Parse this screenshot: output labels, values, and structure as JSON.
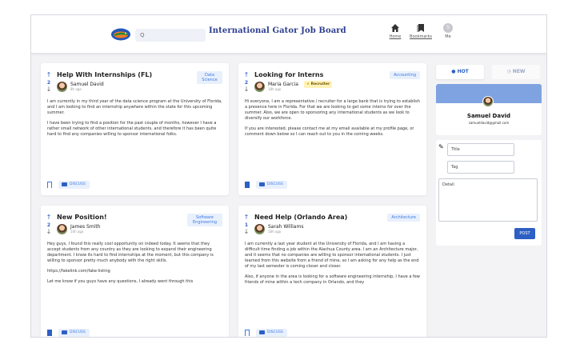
{
  "header": {
    "search_placeholder": "Q",
    "brand": "International Gator Job Board",
    "nav": {
      "home": "Home",
      "bookmarks": "Bookmarks",
      "me": "Me",
      "me_initial": "S"
    }
  },
  "posts": [
    {
      "title": "Help With Internships (FL)",
      "votes": "2",
      "author": "Samuel David",
      "time": "8h ago",
      "tag": "Data Science",
      "body": [
        "I am currently in my third year of the data science program at the University of Florida, and I am looking to find an internship anywhere within the state for this upcoming summer.",
        "I have been trying to find a position for the past couple of months, however I have a rather small network of other international students, and therefore it has been quite hard to find any companies willing to sponsor international folks."
      ],
      "discuss": "DISCUSS",
      "bookmarked": false
    },
    {
      "title": "Looking for Interns",
      "votes": "2",
      "author": "Maria Garcia",
      "badge": "Recruiter",
      "time": "18h ago",
      "tag": "Accounting",
      "body": [
        "Hi everyone, I am a representative / recruiter for a large bank that is trying to establish a presence here in Florida. For that we are looking to get some interns for over the summer. Also, we are open to sponsoring any international students as we look to diversify our workforce.",
        "If you are interested, please contact me at my email available at my profile page, or comment down below so I can reach out to you in the coming weeks."
      ],
      "discuss": "DISCUSS",
      "bookmarked": true
    },
    {
      "title": "New Position!",
      "votes": "2",
      "author": "James Smith",
      "time": "10h ago",
      "tag": "Software Engineering",
      "body": [
        "Hey guys, I found this really cool opportunity on indeed today. It seems that they accept students from any country as they are looking to expand their engineering department. I know its hard to find internships at the moment, but this company is willing to sponsor pretty much anybody with the right skills.",
        "https://fakelink.com/fake-listing",
        "Let me know if you guys have any questions, I already went through this"
      ],
      "discuss": "DISCUSS",
      "bookmarked": true
    },
    {
      "title": "Need Help (Orlando Area)",
      "votes": "1",
      "author": "Sarah Williams",
      "time": "18h ago",
      "tag": "Architecture",
      "body": [
        "I am currently a last year student at the University of Florida, and I am having a difficult time finding a job within the Alachua County area. I am an Architecture major, and it seems that no companies are willing to sponsor international students. I just learned from this website from a friend of mine, so I am asking for any help as the end of my last semester is coming closer and closer.",
        "Also, if anyone in the area is looking for a software engineering internship, I have a few friends of mine within a tech company in Orlando, and they"
      ],
      "discuss": "DISCUSS",
      "bookmarked": false
    }
  ],
  "sidebar": {
    "sort_hot": "HOT",
    "sort_new": "NEW",
    "profile": {
      "name": "Samuel David",
      "email": "samueldavid@gmail.com"
    },
    "form": {
      "title_placeholder": "Title",
      "tag_placeholder": "Tag",
      "detail_placeholder": "Detail",
      "post_label": "POST"
    }
  },
  "colors": {
    "accent": "#2d5fc4",
    "brand": "#2c3e8f",
    "tag_bg": "#e8f0fd",
    "recruiter_bg": "#fff2b8",
    "profile_banner": "#7fa3e0"
  }
}
